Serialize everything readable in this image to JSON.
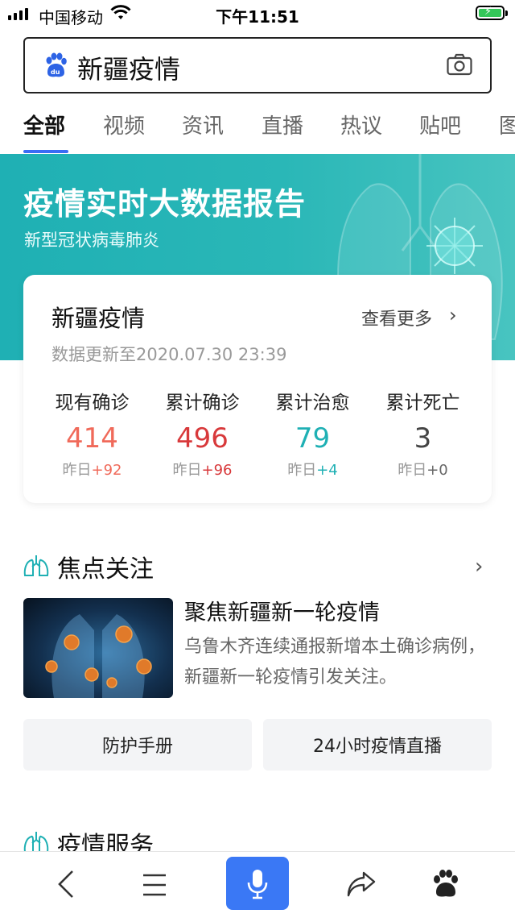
{
  "status_bar": {
    "carrier": "中国移动",
    "time": "下午11:51"
  },
  "search": {
    "query": "新疆疫情",
    "logo_icon": "baidu-paw-icon",
    "camera_icon": "camera-icon"
  },
  "tabs": [
    {
      "label": "全部",
      "active": true
    },
    {
      "label": "视频"
    },
    {
      "label": "资讯"
    },
    {
      "label": "直播"
    },
    {
      "label": "热议"
    },
    {
      "label": "贴吧"
    },
    {
      "label": "图"
    }
  ],
  "banner": {
    "title": "疫情实时大数据报告",
    "subtitle": "新型冠状病毒肺炎"
  },
  "stats_card": {
    "title": "新疆疫情",
    "more_label": "查看更多",
    "update_text": "数据更新至2020.07.30 23:39",
    "stats": [
      {
        "label": "现有确诊",
        "value": "414",
        "delta_prefix": "昨日",
        "delta": "+92",
        "color": "#f06a5a",
        "delta_color": "#f06a5a"
      },
      {
        "label": "累计确诊",
        "value": "496",
        "delta_prefix": "昨日",
        "delta": "+96",
        "color": "#d8393b",
        "delta_color": "#d8393b"
      },
      {
        "label": "累计治愈",
        "value": "79",
        "delta_prefix": "昨日",
        "delta": "+4",
        "color": "#1fb0b4",
        "delta_color": "#1fb0b4"
      },
      {
        "label": "累计死亡",
        "value": "3",
        "delta_prefix": "昨日",
        "delta": "+0",
        "color": "#444444",
        "delta_color": "#666666"
      }
    ]
  },
  "focus": {
    "section_title": "焦点关注",
    "news_title": "聚焦新疆新一轮疫情",
    "news_desc": "乌鲁木齐连续通报新增本土确诊病例，新疆新一轮疫情引发关注。",
    "buttons": [
      "防护手册",
      "24小时疫情直播"
    ]
  },
  "services": {
    "section_title": "疫情服务"
  },
  "toolbar": {
    "icons": [
      "back-icon",
      "menu-icon",
      "microphone-icon",
      "share-icon",
      "baidu-paw-icon"
    ]
  },
  "colors": {
    "accent": "#3a6cf4",
    "banner": "#1fb0b4",
    "mic_button": "#3a78f5"
  }
}
